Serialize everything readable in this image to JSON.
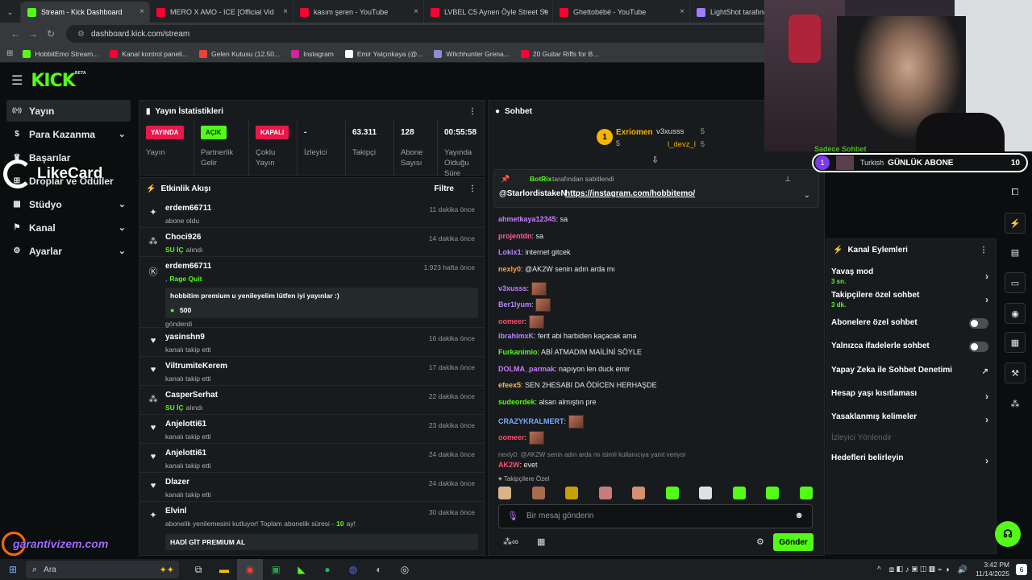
{
  "tabs": [
    {
      "label": "Stream - Kick Dashboard",
      "color": "#53fc18",
      "active": true
    },
    {
      "label": "MERO X AMO - ICE [Official Vid",
      "color": "#ff0033"
    },
    {
      "label": "kasım şeren - YouTube",
      "color": "#ff0033"
    },
    {
      "label": "LVBEL C5 Aynen Öyle Street Se",
      "color": "#ff0033"
    },
    {
      "label": "Ghettobébé - YouTube",
      "color": "#ff0033"
    },
    {
      "label": "LightShot tarafından Ekran Gö",
      "color": "#a27bff"
    }
  ],
  "url": "dashboard.kick.com/stream",
  "bookmarks": [
    {
      "label": "HobbitEmo Stream...",
      "color": "#53fc18"
    },
    {
      "label": "Kanal kontrol paneli...",
      "color": "#ff0033"
    },
    {
      "label": "Gelen Kutusu (12.50...",
      "color": "#ea4335"
    },
    {
      "label": "Instagram",
      "color": "#d6249f"
    },
    {
      "label": "Emir Yalçınkaya (@...",
      "color": "#ffffff"
    },
    {
      "label": "Witchhunter Grena...",
      "color": "#8a8fd0"
    },
    {
      "label": "20 Guitar Riffs for B...",
      "color": "#ff0033"
    }
  ],
  "logo": {
    "text": "KICK",
    "beta": "BETA"
  },
  "sidebar": [
    {
      "label": "Yayın",
      "icon": "broadcast-icon"
    },
    {
      "label": "Para Kazanma",
      "icon": "dollar-icon"
    },
    {
      "label": "Başarılar",
      "icon": "trophy-icon"
    },
    {
      "label": "Droplar ve Ödüller",
      "icon": "gift-icon"
    },
    {
      "label": "Stüdyo",
      "icon": "studio-icon"
    },
    {
      "label": "Kanal",
      "icon": "flag-icon"
    },
    {
      "label": "Ayarlar",
      "icon": "gear-icon"
    }
  ],
  "watermark": {
    "likecard": "LikeCard",
    "garanti": "garantivizem.com"
  },
  "stats": {
    "title": "Yayın İstatistikleri",
    "items": [
      {
        "badge": "YAYINDA",
        "badge_color": "#e8184a",
        "label": "Yayın"
      },
      {
        "badge": "AÇIK",
        "badge_color": "#53fc18",
        "label": "Partnerlik Gelir"
      },
      {
        "badge": "KAPALI",
        "badge_color": "#e8184a",
        "label": "Çoklu Yayın"
      },
      {
        "value": "-",
        "label": "İzleyici"
      },
      {
        "value": "63.311",
        "label": "Takipçi"
      },
      {
        "value": "128",
        "label": "Abone Sayısı"
      },
      {
        "value": "00:55:58",
        "label": "Yayında Olduğu Süre"
      }
    ]
  },
  "activity": {
    "title": "Etkinlik Akışı",
    "filter": "Filtre",
    "items": [
      {
        "icon": "sparkle-icon",
        "name": "erdem66711",
        "sub": "abone oldu",
        "time": "11 dakika önce"
      },
      {
        "icon": "gift-icon",
        "name": "Choci926",
        "sub_green": "SU İÇ",
        "sub": "alındı",
        "time": "14 dakika önce"
      },
      {
        "icon": "kick-icon",
        "name": "erdem66711",
        "sub_pre": ",",
        "sub_green": "Rage Quit",
        "time": "1.923 hafta önce",
        "message": "hobbitim premium u yenileyelim lütfen iyi yayınlar :)",
        "amount": "500",
        "tail": "gönderdi"
      },
      {
        "icon": "heart-icon",
        "name": "yasinshn9",
        "sub": "kanalı takip etti",
        "time": "16 dakika önce"
      },
      {
        "icon": "heart-icon",
        "name": "ViltrumiteKerem",
        "sub": "kanalı takip etti",
        "time": "17 dakika önce"
      },
      {
        "icon": "gift-icon",
        "name": "CasperSerhat",
        "sub_green": "SU İÇ",
        "sub": "alındı",
        "time": "22 dakika önce"
      },
      {
        "icon": "heart-icon",
        "name": "Anjelotti61",
        "sub": "kanalı takip etti",
        "time": "23 dakika önce"
      },
      {
        "icon": "heart-icon",
        "name": "Anjelotti61",
        "sub": "kanalı takip etti",
        "time": "24 dakika önce"
      },
      {
        "icon": "heart-icon",
        "name": "Dlazer",
        "sub": "kanalı takip etti",
        "time": "24 dakika önce"
      },
      {
        "icon": "sparkle-icon",
        "name": "Elvinl",
        "sub": "abonelik yenilemesini kutluyor! Toplam abonelik süresi -",
        "sub_green": "10",
        "sub_post": "ay!",
        "time": "30 dakika önce",
        "message": "HADİ GİT PREMIUM AL"
      }
    ]
  },
  "chat": {
    "title": "Sohbet",
    "top": {
      "first": "Exriomen",
      "first_count": "5",
      "rank": "1",
      "second": "v3xusss",
      "second_count": "5",
      "third": "l_devz_l",
      "third_count": "5"
    },
    "pinned": {
      "by": "BotRix",
      "by_text": "tarafından sabitlendi",
      "user": "@StarlordistakeN",
      "link": "https://instagram.com/hobbitemo/"
    },
    "messages": [
      {
        "user": "ahmetkaya12345",
        "color": "#c77dff",
        "text": "sa"
      },
      {
        "user": "projentdn",
        "color": "#ff5c93",
        "text": "sa"
      },
      {
        "user": "Lokix1",
        "color": "#b388ff",
        "text": "internet gitcek"
      },
      {
        "user": "nexly0",
        "color": "#ff9f43",
        "text": "@AK2W senin adın arda mı"
      },
      {
        "user": "v3xusss",
        "color": "#c77dff",
        "text": "",
        "emote": true
      },
      {
        "user": "Ber1lyum",
        "color": "#b388ff",
        "text": "",
        "emote": true
      },
      {
        "user": "oomeer",
        "color": "#ff4d6d",
        "text": "",
        "emote": true
      },
      {
        "user": "ibrahimxK",
        "color": "#b388ff",
        "text": "ferit abi harbiden kaçacak ama"
      },
      {
        "user": "Furkanimio",
        "color": "#53fc18",
        "text": "ABİ ATMADIM MAİLİNİ SÖYLE"
      },
      {
        "user": "DOLMA_parmak",
        "color": "#c77dff",
        "text": "napıyon len duck emir"
      },
      {
        "user": "efeex5",
        "color": "#ffb347",
        "text": "SEN 2HESABI DA ÖDİCEN HERHAŞDE"
      },
      {
        "user": "sudeordek",
        "color": "#53fc18",
        "text": "alsan almıştın pre"
      },
      {
        "user": "CRAZYKRALMERT",
        "color": "#7aa7ff",
        "text": "",
        "emote": true
      },
      {
        "user": "oomeer",
        "color": "#ff4d6d",
        "text": "",
        "emote": true
      },
      {
        "reply": "nexly0: @AK2W senin adın arda mı isimli kullanıcıya yanıt veriyor",
        "user": "AK2W",
        "color": "#ff4d6d",
        "text": "evet"
      }
    ],
    "followers_only": "Takipçilere Özel",
    "input_placeholder": "Bir mesaj gönderin",
    "send": "Gönder",
    "stream_chat_label": "Sadece Sohbet"
  },
  "goal": {
    "rank": "1",
    "language": "Turkish",
    "title": "GÜNLÜK ABONE",
    "count": "10"
  },
  "actions": {
    "title": "Kanal Eylemleri",
    "items": [
      {
        "label": "Yavaş mod",
        "sub": "3 sn.",
        "type": "chevron"
      },
      {
        "label": "Takipçilere özel sohbet",
        "sub": "3 dk.",
        "type": "chevron"
      },
      {
        "label": "Abonelere özel sohbet",
        "type": "toggle"
      },
      {
        "label": "Yalnızca ifadelerle sohbet",
        "type": "toggle"
      },
      {
        "label": "Yapay Zeka ile Sohbet Denetimi",
        "type": "external"
      },
      {
        "label": "Hesap yaşı kısıtlaması",
        "type": "chevron"
      },
      {
        "label": "Yasaklanmış kelimeler",
        "type": "chevron"
      },
      {
        "label": "İzleyici Yönlendir",
        "type": "disabled"
      },
      {
        "label": "Hedefleri belirleyin",
        "type": "chevron"
      }
    ]
  },
  "taskbar": {
    "search": "Ara",
    "time": "3:42 PM",
    "date": "11/14/2025",
    "notif": "6"
  }
}
